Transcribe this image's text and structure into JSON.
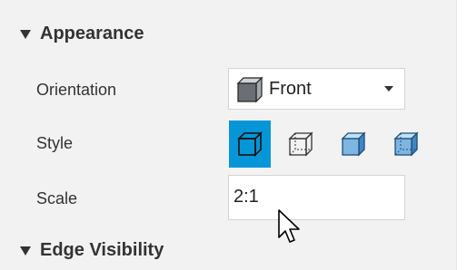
{
  "appearance": {
    "header": "Appearance",
    "orientation": {
      "label": "Orientation",
      "value": "Front",
      "icon": "cube-front-icon"
    },
    "style": {
      "label": "Style",
      "options": [
        {
          "icon": "cube-visible-edges-icon",
          "selected": true
        },
        {
          "icon": "cube-hidden-edges-icon",
          "selected": false
        },
        {
          "icon": "cube-shaded-icon",
          "selected": false
        },
        {
          "icon": "cube-shaded-hidden-edges-icon",
          "selected": false
        }
      ]
    },
    "scale": {
      "label": "Scale",
      "value": "2:1"
    }
  },
  "edge_visibility": {
    "header": "Edge Visibility"
  },
  "colors": {
    "accent": "#0696d7",
    "panel_bg": "#f2f2f2"
  }
}
